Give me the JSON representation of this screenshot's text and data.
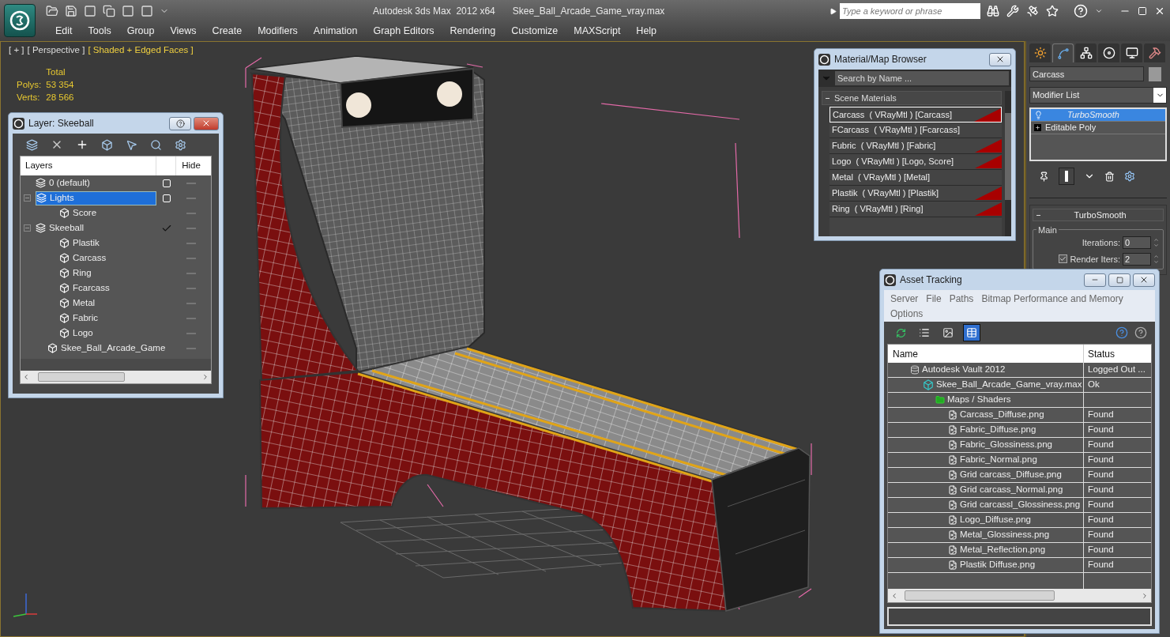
{
  "title_bar": {
    "app_title": "Autodesk 3ds Max  2012 x64",
    "file_name": "Skee_Ball_Arcade_Game_vray.max",
    "search": {
      "placeholder": "Type a keyword or phrase"
    }
  },
  "menu": [
    "Edit",
    "Tools",
    "Group",
    "Views",
    "Create",
    "Modifiers",
    "Animation",
    "Graph Editors",
    "Rendering",
    "Customize",
    "MAXScript",
    "Help"
  ],
  "viewport": {
    "labels": [
      {
        "text": "[ + ]",
        "highlighted": false
      },
      {
        "text": "[ Perspective ]",
        "highlighted": false
      },
      {
        "text": "[ Shaded + Edged Faces ]",
        "highlighted": true
      }
    ],
    "stats": {
      "header": "Total",
      "rows": [
        {
          "label": "Polys:",
          "value": "53 354"
        },
        {
          "label": "Verts:",
          "value": "28 566"
        }
      ]
    }
  },
  "layer_window": {
    "title": "Layer: Skeeball",
    "columns": [
      "Layers",
      "Hide"
    ],
    "layers": [
      {
        "name": "0 (default)",
        "kind": "layer",
        "selected": false,
        "current": false
      },
      {
        "name": "Lights",
        "kind": "layer",
        "selected": true,
        "current": false,
        "expanded": true,
        "children": [
          {
            "name": "Score",
            "kind": "object",
            "selected": false
          }
        ]
      },
      {
        "name": "Skeeball",
        "kind": "layer",
        "selected": false,
        "current": true,
        "expanded": true,
        "children": [
          {
            "name": "Plastik",
            "kind": "object",
            "selected": false
          },
          {
            "name": "Carcass",
            "kind": "object",
            "selected": false
          },
          {
            "name": "Ring",
            "kind": "object",
            "selected": false
          },
          {
            "name": "Fcarcass",
            "kind": "object",
            "selected": false
          },
          {
            "name": "Metal",
            "kind": "object",
            "selected": false
          },
          {
            "name": "Fabric",
            "kind": "object",
            "selected": false
          },
          {
            "name": "Logo",
            "kind": "object",
            "selected": false
          },
          {
            "name": "Skee_Ball_Arcade_Game",
            "kind": "object",
            "selected": false
          }
        ]
      }
    ]
  },
  "material_browser": {
    "title": "Material/Map Browser",
    "search": {
      "placeholder": "Search by Name ..."
    },
    "group": {
      "label": "Scene Materials",
      "expanded": true
    },
    "materials": [
      {
        "name": "Carcass  ( VRayMtl ) [Carcass]",
        "selected": true,
        "assigned": true
      },
      {
        "name": "FCarcass  ( VRayMtl ) [Fcarcass]",
        "selected": false,
        "assigned": false
      },
      {
        "name": "Fubric  ( VRayMtl ) [Fabric]",
        "selected": false,
        "assigned": true
      },
      {
        "name": "Logo  ( VRayMtl ) [Logo, Score]",
        "selected": false,
        "assigned": true
      },
      {
        "name": "Metal  ( VRayMtl ) [Metal]",
        "selected": false,
        "assigned": false
      },
      {
        "name": "Plastik  ( VRayMtl ) [Plastik]",
        "selected": false,
        "assigned": true
      },
      {
        "name": "Ring  ( VRayMtl ) [Ring]",
        "selected": false,
        "assigned": true
      }
    ]
  },
  "asset_tracking": {
    "title": "Asset Tracking",
    "menu": [
      "Server",
      "File",
      "Paths",
      "Bitmap Performance and Memory",
      "Options"
    ],
    "view_buttons": [
      {
        "kind": "refresh",
        "selected": false
      },
      {
        "kind": "list",
        "selected": false
      },
      {
        "kind": "thumbnails",
        "selected": false
      },
      {
        "kind": "table",
        "selected": true
      }
    ],
    "columns": [
      "Name",
      "Status"
    ],
    "rows": [
      {
        "name": "Autodesk Vault 2012",
        "status": "Logged Out ...",
        "kind": "vault",
        "children": [
          {
            "name": "Skee_Ball_Arcade_Game_vray.max",
            "status": "Ok",
            "kind": "scene",
            "children": [
              {
                "name": "Maps / Shaders",
                "kind": "folder",
                "children": [
                  {
                    "name": "Carcass_Diffuse.png",
                    "status": "Found",
                    "kind": "bitmap"
                  },
                  {
                    "name": "Fabric_Diffuse.png",
                    "status": "Found",
                    "kind": "bitmap"
                  },
                  {
                    "name": "Fabric_Glossiness.png",
                    "status": "Found",
                    "kind": "bitmap"
                  },
                  {
                    "name": "Fabric_Normal.png",
                    "status": "Found",
                    "kind": "bitmap"
                  },
                  {
                    "name": "Grid carcass_Diffuse.png",
                    "status": "Found",
                    "kind": "bitmap"
                  },
                  {
                    "name": "Grid carcass_Normal.png",
                    "status": "Found",
                    "kind": "bitmap"
                  },
                  {
                    "name": "Grid carcassl_Glossiness.png",
                    "status": "Found",
                    "kind": "bitmap"
                  },
                  {
                    "name": "Logo_Diffuse.png",
                    "status": "Found",
                    "kind": "bitmap"
                  },
                  {
                    "name": "Metal_Glossiness.png",
                    "status": "Found",
                    "kind": "bitmap"
                  },
                  {
                    "name": "Metal_Reflection.png",
                    "status": "Found",
                    "kind": "bitmap"
                  },
                  {
                    "name": "Plastik Diffuse.png",
                    "status": "Found",
                    "kind": "bitmap"
                  }
                ]
              }
            ]
          }
        ]
      }
    ]
  },
  "command_panel": {
    "tabs": [
      {
        "kind": "create",
        "selected": false
      },
      {
        "kind": "modify",
        "selected": true
      },
      {
        "kind": "hierarchy",
        "selected": false
      },
      {
        "kind": "motion",
        "selected": false
      },
      {
        "kind": "display",
        "selected": false
      },
      {
        "kind": "utilities",
        "selected": false
      }
    ],
    "object_name": "Carcass",
    "modifier_list": "Modifier List",
    "stack": [
      {
        "name": "TurboSmooth",
        "kind": "modifier",
        "selected": true
      },
      {
        "name": "Editable Poly",
        "kind": "base",
        "selected": false
      }
    ],
    "rollout": {
      "title": "TurboSmooth",
      "expanded": true,
      "group": "Main",
      "iterations": {
        "label": "Iterations:",
        "value": "0"
      },
      "render_iters": {
        "label": "Render Iters:",
        "value": "2",
        "checked": true
      }
    }
  }
}
